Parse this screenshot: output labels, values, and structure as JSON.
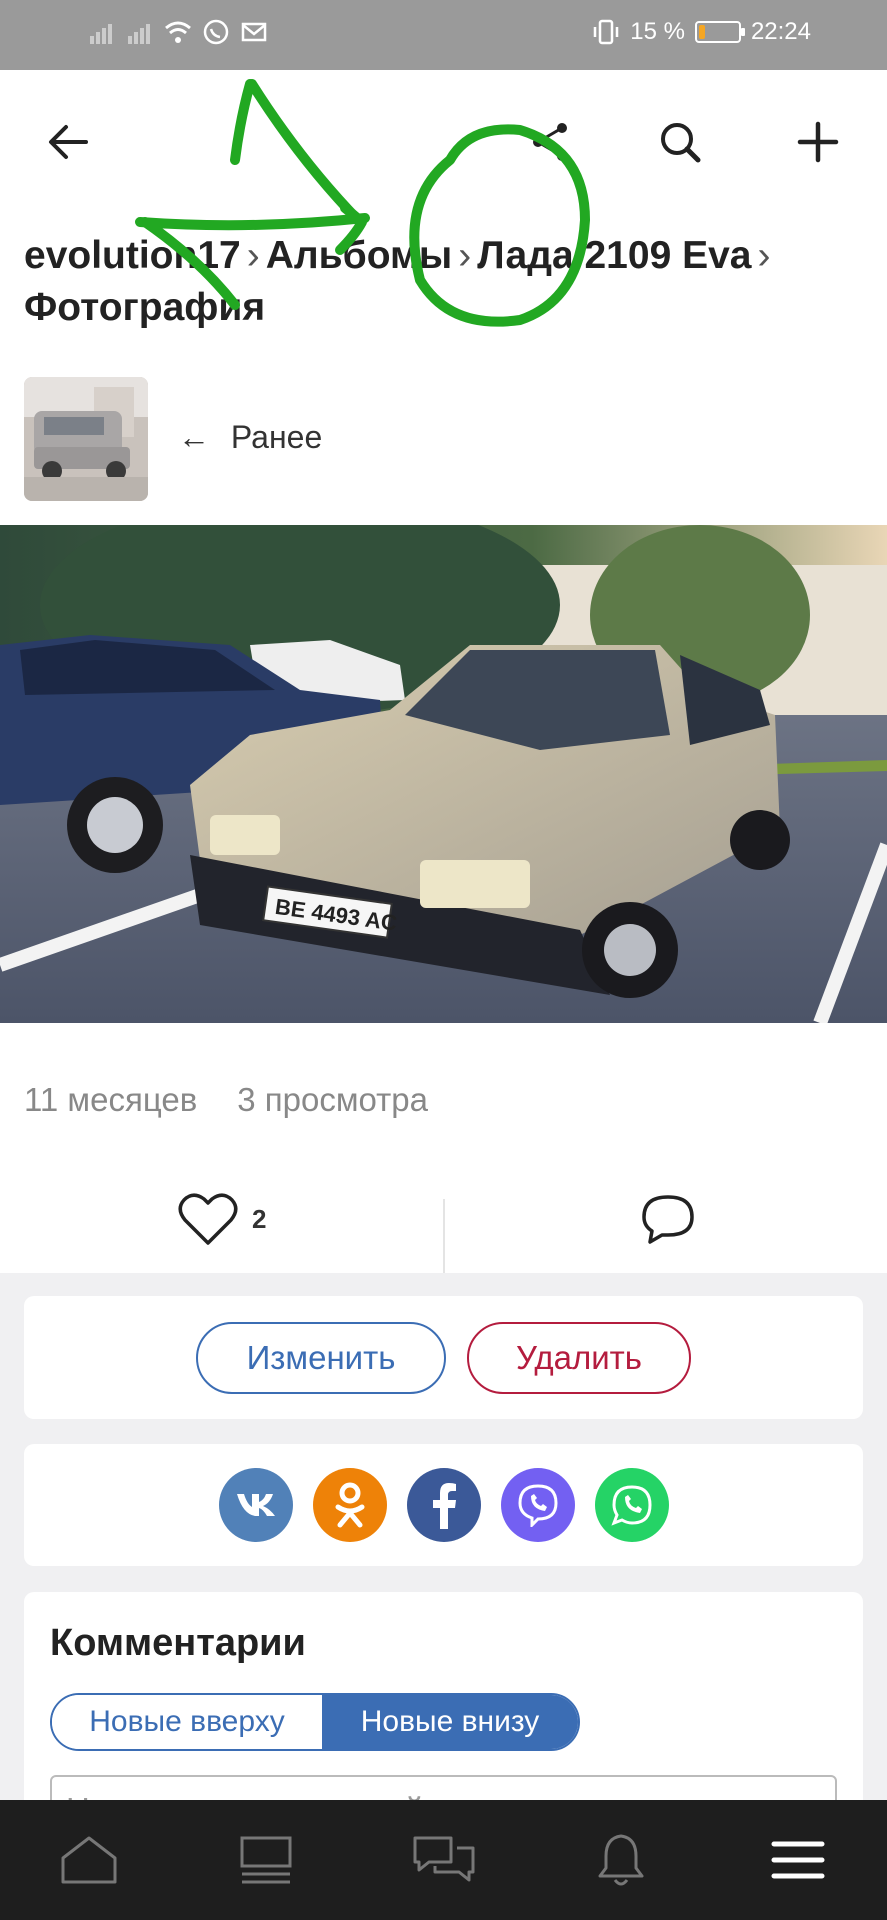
{
  "status_bar": {
    "battery_percent": "15 %",
    "battery_level": 0.15,
    "time": "22:24",
    "icons": [
      "signal-icon",
      "signal-icon",
      "wifi-icon",
      "whatsapp-icon",
      "mail-icon",
      "vibrate-icon"
    ]
  },
  "topbar": {
    "icons": [
      "back-arrow-icon",
      "share-icon",
      "search-icon",
      "plus-icon"
    ]
  },
  "breadcrumbs": {
    "user": "evolution17",
    "albums": "Альбомы",
    "album": "Лада 2109 Eva",
    "current": "Фотография",
    "separator": "›"
  },
  "prev": {
    "arrow": "←",
    "label": "Ранее"
  },
  "meta": {
    "age": "11 месяцев",
    "views": "3 просмотра"
  },
  "actions": {
    "likes": "2"
  },
  "manage": {
    "edit_label": "Изменить",
    "delete_label": "Удалить"
  },
  "share": {
    "items": [
      {
        "name": "vk",
        "label": "vk",
        "color": "#5181b8"
      },
      {
        "name": "odnoklassniki",
        "label": "ok",
        "color": "#ee8208"
      },
      {
        "name": "facebook",
        "label": "f",
        "color": "#3b5998"
      },
      {
        "name": "viber",
        "label": "viber",
        "color": "#7360f2"
      },
      {
        "name": "whatsapp",
        "label": "whatsapp",
        "color": "#25d366"
      }
    ]
  },
  "comments": {
    "title": "Комментарии",
    "sort_newest_top": "Новые вверху",
    "sort_newest_bottom": "Новые внизу",
    "input_placeholder": "Написать комментарий"
  },
  "bottom_nav": {
    "icons": [
      "home-icon",
      "feed-icon",
      "messages-icon",
      "bell-icon",
      "menu-icon"
    ]
  },
  "colors": {
    "accent": "#3b6db4",
    "danger": "#b41c3e",
    "scribble": "#22a822"
  }
}
